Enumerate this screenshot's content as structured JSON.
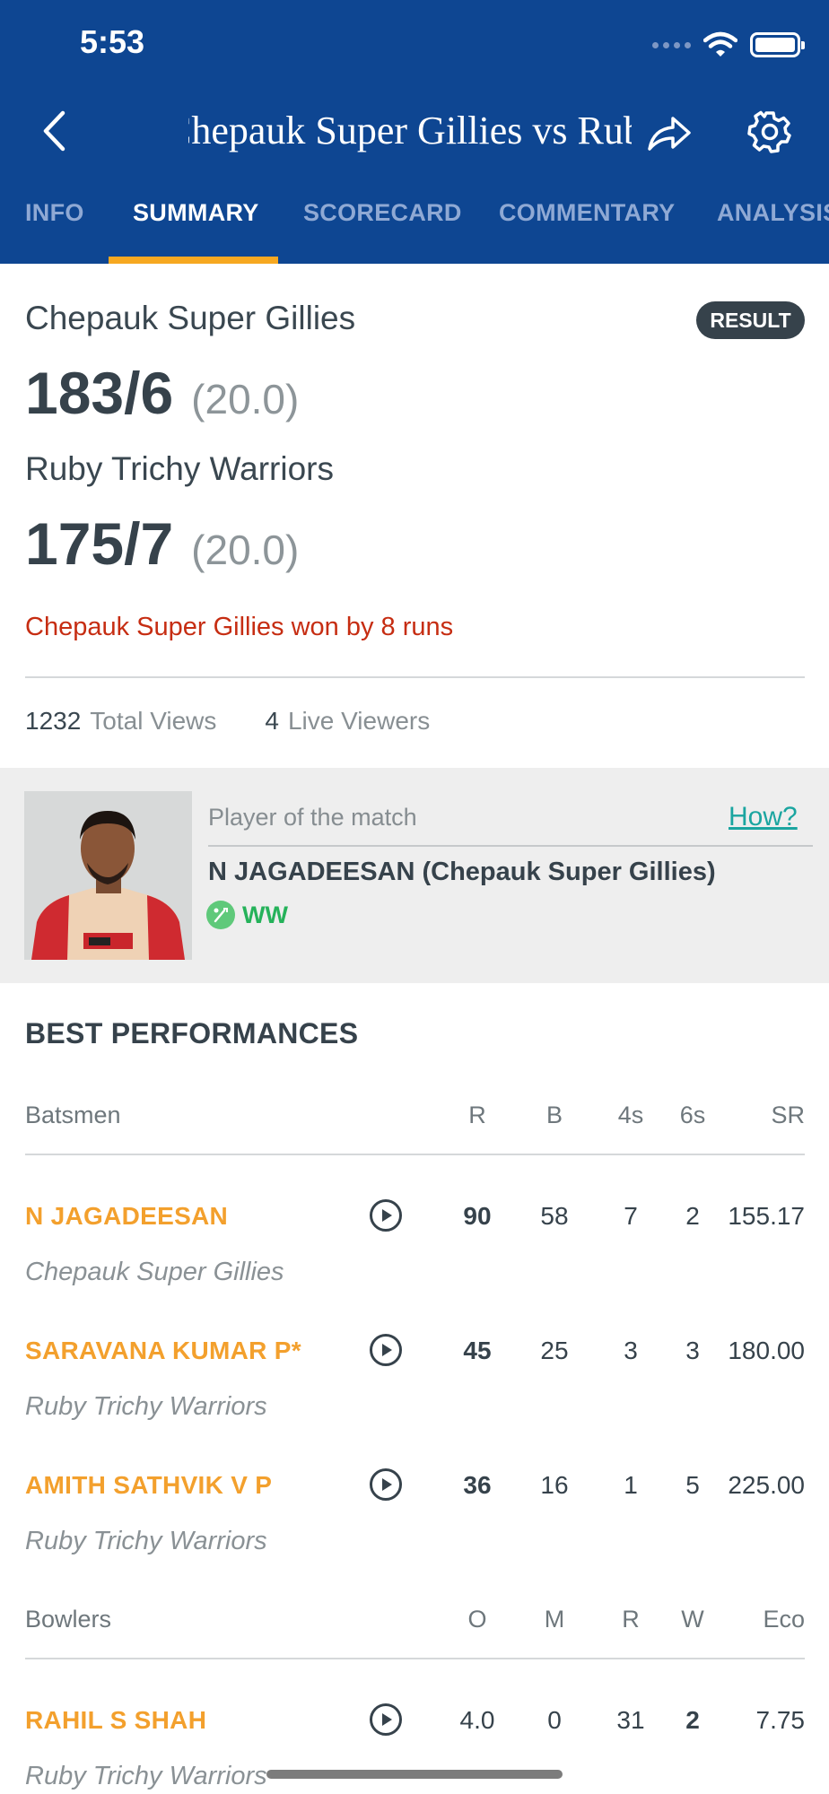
{
  "status_bar": {
    "time": "5:53"
  },
  "header": {
    "title": "Chepauk Super Gillies vs Ruby Trichy Warriors",
    "back_icon": "chevron-left-icon",
    "share_icon": "share-icon",
    "settings_icon": "gear-icon"
  },
  "tabs": [
    {
      "label": "INFO"
    },
    {
      "label": "SUMMARY"
    },
    {
      "label": "SCORECARD"
    },
    {
      "label": "COMMENTARY"
    },
    {
      "label": "ANALYSIS"
    }
  ],
  "active_tab": "SUMMARY",
  "summary": {
    "team1": {
      "name": "Chepauk Super Gillies",
      "score": "183/6",
      "overs": "(20.0)"
    },
    "team2": {
      "name": "Ruby Trichy Warriors",
      "score": "175/7",
      "overs": "(20.0)"
    },
    "badge": "RESULT",
    "result": "Chepauk Super Gillies won by 8 runs",
    "views": {
      "total": "1232",
      "total_label": "Total Views",
      "live": "4",
      "live_label": "Live Viewers"
    }
  },
  "potm": {
    "label": "Player of the match",
    "how": "How?",
    "name": "N JAGADEESAN (Chepauk Super Gillies)",
    "role": "WW"
  },
  "best": {
    "title": "BEST PERFORMANCES",
    "batting_headers": {
      "name": "Batsmen",
      "r": "R",
      "b": "B",
      "fours": "4s",
      "sixes": "6s",
      "sr": "SR"
    },
    "batsmen": [
      {
        "name": "N JAGADEESAN",
        "team": "Chepauk Super Gillies",
        "r": "90",
        "b": "58",
        "fours": "7",
        "sixes": "2",
        "sr": "155.17"
      },
      {
        "name": "SARAVANA KUMAR P*",
        "team": "Ruby Trichy Warriors",
        "r": "45",
        "b": "25",
        "fours": "3",
        "sixes": "3",
        "sr": "180.00"
      },
      {
        "name": "AMITH SATHVIK V P",
        "team": "Ruby Trichy Warriors",
        "r": "36",
        "b": "16",
        "fours": "1",
        "sixes": "5",
        "sr": "225.00"
      }
    ],
    "bowling_headers": {
      "name": "Bowlers",
      "o": "O",
      "m": "M",
      "r": "R",
      "w": "W",
      "eco": "Eco"
    },
    "bowlers": [
      {
        "name": "RAHIL S SHAH",
        "team": "Ruby Trichy Warriors",
        "o": "4.0",
        "m": "0",
        "r": "31",
        "w": "2",
        "eco": "7.75"
      }
    ]
  },
  "colors": {
    "header_bg": "#0e4692",
    "tab_indicator": "#f6a821",
    "player_name": "#f3a02d",
    "result_text": "#c62d12",
    "role_text": "#25b25a"
  }
}
